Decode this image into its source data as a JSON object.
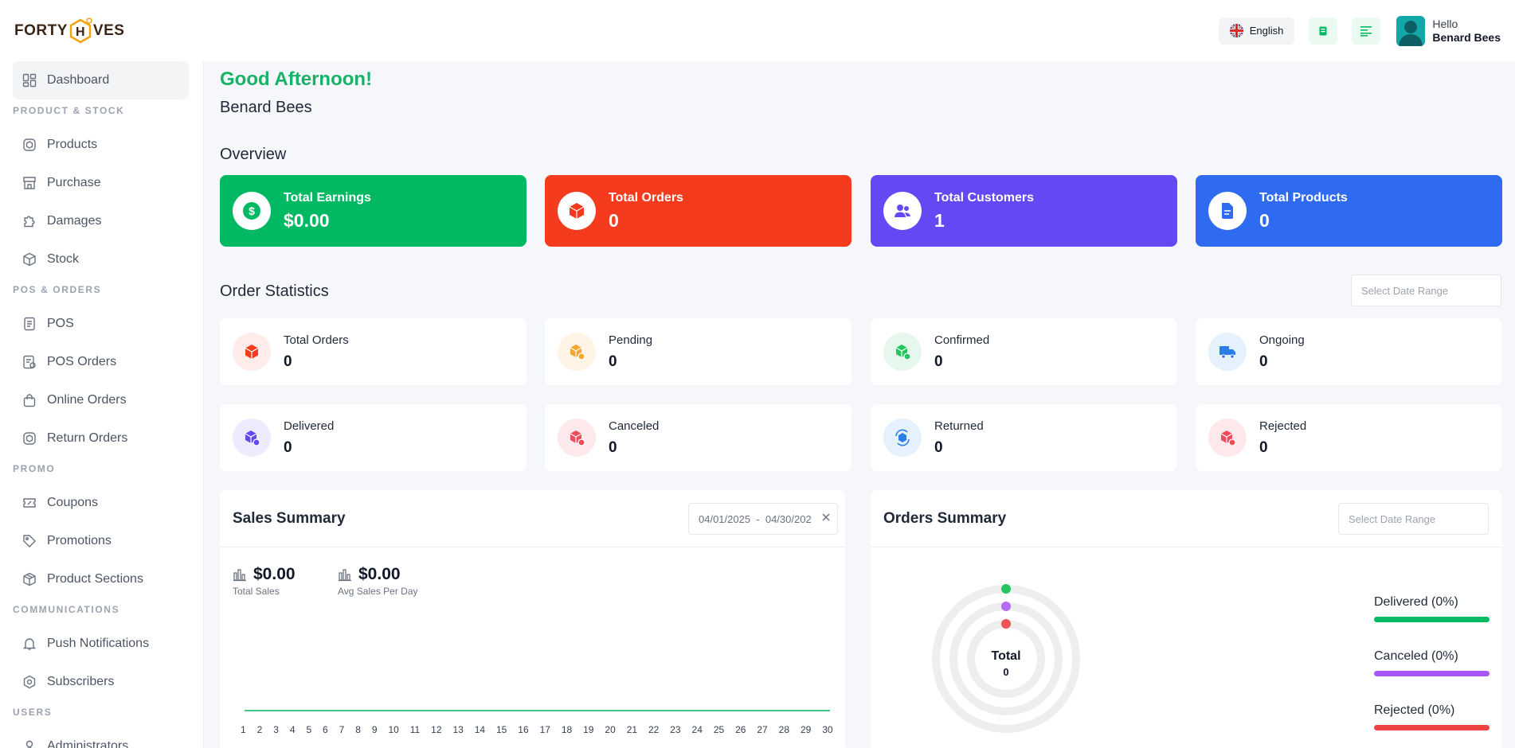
{
  "header": {
    "logo_left": "FORTY",
    "logo_mid": "H",
    "logo_right": "VES",
    "language": "English",
    "hello": "Hello",
    "user_name": "Benard Bees"
  },
  "sidebar": {
    "dashboard": "Dashboard",
    "section_product": "PRODUCT & STOCK",
    "products": "Products",
    "purchase": "Purchase",
    "damages": "Damages",
    "stock": "Stock",
    "section_pos": "POS & ORDERS",
    "pos": "POS",
    "pos_orders": "POS Orders",
    "online_orders": "Online Orders",
    "return_orders": "Return Orders",
    "section_promo": "PROMO",
    "coupons": "Coupons",
    "promotions": "Promotions",
    "product_sections": "Product Sections",
    "section_comm": "COMMUNICATIONS",
    "push_notifications": "Push Notifications",
    "subscribers": "Subscribers",
    "section_users": "USERS",
    "administrators": "Administrators"
  },
  "main": {
    "greeting": "Good Afternoon!",
    "name": "Benard Bees",
    "overview_title": "Overview",
    "overview": {
      "earnings_label": "Total Earnings",
      "earnings_value": "$0.00",
      "orders_label": "Total Orders",
      "orders_value": "0",
      "customers_label": "Total Customers",
      "customers_value": "1",
      "products_label": "Total Products",
      "products_value": "0"
    },
    "order_stats_title": "Order Statistics",
    "date_range_placeholder": "Select Date Range",
    "stats": {
      "total_orders": "Total Orders",
      "total_orders_value": "0",
      "pending": "Pending",
      "pending_value": "0",
      "confirmed": "Confirmed",
      "confirmed_value": "0",
      "ongoing": "Ongoing",
      "ongoing_value": "0",
      "delivered": "Delivered",
      "delivered_value": "0",
      "canceled": "Canceled",
      "canceled_value": "0",
      "returned": "Returned",
      "returned_value": "0",
      "rejected": "Rejected",
      "rejected_value": "0"
    },
    "sales_summary": {
      "title": "Sales Summary",
      "date_range": "04/01/2025  -  04/30/202",
      "total_sales": "$0.00",
      "total_sales_label": "Total Sales",
      "avg_sales": "$0.00",
      "avg_sales_label": "Avg Sales Per Day"
    },
    "orders_summary": {
      "title": "Orders Summary",
      "total_label": "Total",
      "total_value": "0",
      "delivered": "Delivered (0%)",
      "canceled": "Canceled (0%)",
      "rejected": "Rejected (0%)"
    }
  },
  "colors": {
    "green": "#00b962",
    "red": "#f43b1e",
    "purple": "#6448f3",
    "blue": "#2f6bf0"
  },
  "chart_data": {
    "type": "line",
    "x": [
      "1",
      "2",
      "3",
      "4",
      "5",
      "6",
      "7",
      "8",
      "9",
      "10",
      "11",
      "12",
      "13",
      "14",
      "15",
      "16",
      "17",
      "18",
      "19",
      "20",
      "21",
      "22",
      "23",
      "24",
      "25",
      "26",
      "27",
      "28",
      "29",
      "30"
    ],
    "series": [
      {
        "values": [
          0,
          0,
          0,
          0,
          0,
          0,
          0,
          0,
          0,
          0,
          0,
          0,
          0,
          0,
          0,
          0,
          0,
          0,
          0,
          0,
          0,
          0,
          0,
          0,
          0,
          0,
          0,
          0,
          0,
          0
        ]
      }
    ]
  }
}
